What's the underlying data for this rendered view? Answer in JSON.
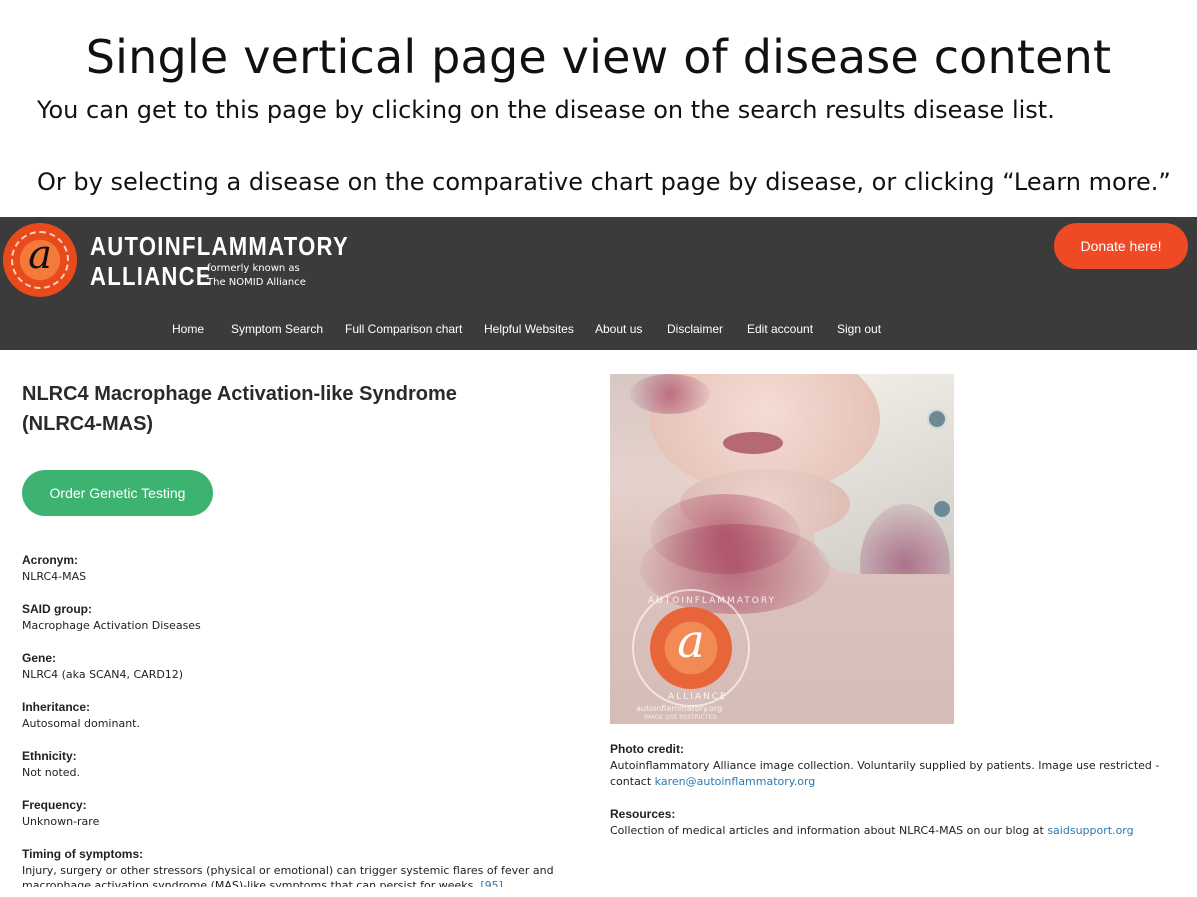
{
  "slide": {
    "title": "Single vertical page view of disease content",
    "line1": "You can get to this page by clicking on the disease on the search results disease list.",
    "line2": "Or by selecting a disease on the comparative chart page by disease, or clicking “Learn more.”"
  },
  "header": {
    "logo_glyph": "a",
    "brand_line1": "AUTOINFLAMMATORY",
    "brand_line2": "ALLIANCE",
    "formerly_line1": "formerly known as",
    "formerly_line2": "The NOMID Alliance",
    "donate_label": "Donate here!",
    "accent_color": "#ef4a25"
  },
  "nav": {
    "items": [
      {
        "label": "Home"
      },
      {
        "label": "Symptom Search"
      },
      {
        "label": "Full Comparison chart"
      },
      {
        "label": "Helpful Websites"
      },
      {
        "label": "About us"
      },
      {
        "label": "Disclaimer"
      },
      {
        "label": "Edit account"
      },
      {
        "label": "Sign out"
      }
    ]
  },
  "disease": {
    "title": "NLRC4 Macrophage Activation-like Syndrome (NLRC4-MAS)",
    "order_button": "Order Genetic Testing",
    "fields": [
      {
        "label": "Acronym:",
        "value": "NLRC4-MAS"
      },
      {
        "label": "SAID group:",
        "value": "Macrophage Activation Diseases"
      },
      {
        "label": "Gene:",
        "value": "NLRC4 (aka SCAN4, CARD12)"
      },
      {
        "label": "Inheritance:",
        "value": "Autosomal dominant."
      },
      {
        "label": "Ethnicity:",
        "value": "Not noted."
      },
      {
        "label": "Frequency:",
        "value": "Unknown-rare"
      }
    ],
    "timing": {
      "label": "Timing of symptoms:",
      "value": "Injury, surgery or other stressors (physical or emotional) can trigger systemic flares of fever and macrophage activation syndrome (MAS)-like symptoms that can persist for weeks.",
      "ref": "[95]"
    }
  },
  "photo": {
    "watermark_top": "AUTOINFLAMMATORY",
    "watermark_bottom": "ALLIANCE",
    "watermark_glyph": "a",
    "watermark_url": "autoinflammatory.org",
    "watermark_restricted": "IMAGE USE RESTRICTED",
    "credit_label": "Photo credit:",
    "credit_text": "Autoinflammatory Alliance image collection. Voluntarily supplied by patients. Image use restricted - contact ",
    "credit_email": "karen@autoinflammatory.org",
    "resources_label": "Resources:",
    "resources_text": "Collection of medical articles and information about NLRC4-MAS on our blog at ",
    "resources_link": "saidsupport.org"
  }
}
